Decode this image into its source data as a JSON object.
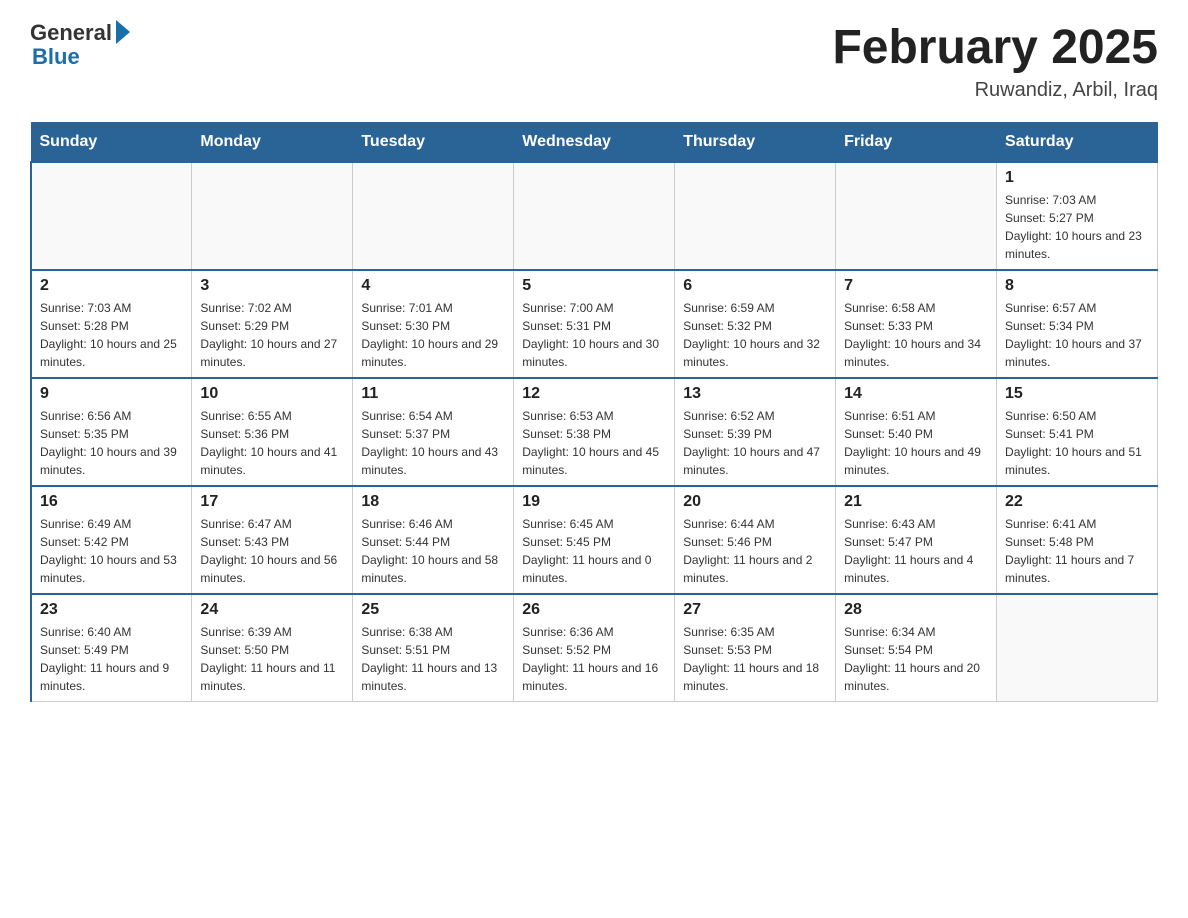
{
  "logo": {
    "general": "General",
    "blue": "Blue"
  },
  "title": "February 2025",
  "subtitle": "Ruwandiz, Arbil, Iraq",
  "weekdays": [
    "Sunday",
    "Monday",
    "Tuesday",
    "Wednesday",
    "Thursday",
    "Friday",
    "Saturday"
  ],
  "weeks": [
    [
      {
        "day": "",
        "sunrise": "",
        "sunset": "",
        "daylight": ""
      },
      {
        "day": "",
        "sunrise": "",
        "sunset": "",
        "daylight": ""
      },
      {
        "day": "",
        "sunrise": "",
        "sunset": "",
        "daylight": ""
      },
      {
        "day": "",
        "sunrise": "",
        "sunset": "",
        "daylight": ""
      },
      {
        "day": "",
        "sunrise": "",
        "sunset": "",
        "daylight": ""
      },
      {
        "day": "",
        "sunrise": "",
        "sunset": "",
        "daylight": ""
      },
      {
        "day": "1",
        "sunrise": "Sunrise: 7:03 AM",
        "sunset": "Sunset: 5:27 PM",
        "daylight": "Daylight: 10 hours and 23 minutes."
      }
    ],
    [
      {
        "day": "2",
        "sunrise": "Sunrise: 7:03 AM",
        "sunset": "Sunset: 5:28 PM",
        "daylight": "Daylight: 10 hours and 25 minutes."
      },
      {
        "day": "3",
        "sunrise": "Sunrise: 7:02 AM",
        "sunset": "Sunset: 5:29 PM",
        "daylight": "Daylight: 10 hours and 27 minutes."
      },
      {
        "day": "4",
        "sunrise": "Sunrise: 7:01 AM",
        "sunset": "Sunset: 5:30 PM",
        "daylight": "Daylight: 10 hours and 29 minutes."
      },
      {
        "day": "5",
        "sunrise": "Sunrise: 7:00 AM",
        "sunset": "Sunset: 5:31 PM",
        "daylight": "Daylight: 10 hours and 30 minutes."
      },
      {
        "day": "6",
        "sunrise": "Sunrise: 6:59 AM",
        "sunset": "Sunset: 5:32 PM",
        "daylight": "Daylight: 10 hours and 32 minutes."
      },
      {
        "day": "7",
        "sunrise": "Sunrise: 6:58 AM",
        "sunset": "Sunset: 5:33 PM",
        "daylight": "Daylight: 10 hours and 34 minutes."
      },
      {
        "day": "8",
        "sunrise": "Sunrise: 6:57 AM",
        "sunset": "Sunset: 5:34 PM",
        "daylight": "Daylight: 10 hours and 37 minutes."
      }
    ],
    [
      {
        "day": "9",
        "sunrise": "Sunrise: 6:56 AM",
        "sunset": "Sunset: 5:35 PM",
        "daylight": "Daylight: 10 hours and 39 minutes."
      },
      {
        "day": "10",
        "sunrise": "Sunrise: 6:55 AM",
        "sunset": "Sunset: 5:36 PM",
        "daylight": "Daylight: 10 hours and 41 minutes."
      },
      {
        "day": "11",
        "sunrise": "Sunrise: 6:54 AM",
        "sunset": "Sunset: 5:37 PM",
        "daylight": "Daylight: 10 hours and 43 minutes."
      },
      {
        "day": "12",
        "sunrise": "Sunrise: 6:53 AM",
        "sunset": "Sunset: 5:38 PM",
        "daylight": "Daylight: 10 hours and 45 minutes."
      },
      {
        "day": "13",
        "sunrise": "Sunrise: 6:52 AM",
        "sunset": "Sunset: 5:39 PM",
        "daylight": "Daylight: 10 hours and 47 minutes."
      },
      {
        "day": "14",
        "sunrise": "Sunrise: 6:51 AM",
        "sunset": "Sunset: 5:40 PM",
        "daylight": "Daylight: 10 hours and 49 minutes."
      },
      {
        "day": "15",
        "sunrise": "Sunrise: 6:50 AM",
        "sunset": "Sunset: 5:41 PM",
        "daylight": "Daylight: 10 hours and 51 minutes."
      }
    ],
    [
      {
        "day": "16",
        "sunrise": "Sunrise: 6:49 AM",
        "sunset": "Sunset: 5:42 PM",
        "daylight": "Daylight: 10 hours and 53 minutes."
      },
      {
        "day": "17",
        "sunrise": "Sunrise: 6:47 AM",
        "sunset": "Sunset: 5:43 PM",
        "daylight": "Daylight: 10 hours and 56 minutes."
      },
      {
        "day": "18",
        "sunrise": "Sunrise: 6:46 AM",
        "sunset": "Sunset: 5:44 PM",
        "daylight": "Daylight: 10 hours and 58 minutes."
      },
      {
        "day": "19",
        "sunrise": "Sunrise: 6:45 AM",
        "sunset": "Sunset: 5:45 PM",
        "daylight": "Daylight: 11 hours and 0 minutes."
      },
      {
        "day": "20",
        "sunrise": "Sunrise: 6:44 AM",
        "sunset": "Sunset: 5:46 PM",
        "daylight": "Daylight: 11 hours and 2 minutes."
      },
      {
        "day": "21",
        "sunrise": "Sunrise: 6:43 AM",
        "sunset": "Sunset: 5:47 PM",
        "daylight": "Daylight: 11 hours and 4 minutes."
      },
      {
        "day": "22",
        "sunrise": "Sunrise: 6:41 AM",
        "sunset": "Sunset: 5:48 PM",
        "daylight": "Daylight: 11 hours and 7 minutes."
      }
    ],
    [
      {
        "day": "23",
        "sunrise": "Sunrise: 6:40 AM",
        "sunset": "Sunset: 5:49 PM",
        "daylight": "Daylight: 11 hours and 9 minutes."
      },
      {
        "day": "24",
        "sunrise": "Sunrise: 6:39 AM",
        "sunset": "Sunset: 5:50 PM",
        "daylight": "Daylight: 11 hours and 11 minutes."
      },
      {
        "day": "25",
        "sunrise": "Sunrise: 6:38 AM",
        "sunset": "Sunset: 5:51 PM",
        "daylight": "Daylight: 11 hours and 13 minutes."
      },
      {
        "day": "26",
        "sunrise": "Sunrise: 6:36 AM",
        "sunset": "Sunset: 5:52 PM",
        "daylight": "Daylight: 11 hours and 16 minutes."
      },
      {
        "day": "27",
        "sunrise": "Sunrise: 6:35 AM",
        "sunset": "Sunset: 5:53 PM",
        "daylight": "Daylight: 11 hours and 18 minutes."
      },
      {
        "day": "28",
        "sunrise": "Sunrise: 6:34 AM",
        "sunset": "Sunset: 5:54 PM",
        "daylight": "Daylight: 11 hours and 20 minutes."
      },
      {
        "day": "",
        "sunrise": "",
        "sunset": "",
        "daylight": ""
      }
    ]
  ]
}
